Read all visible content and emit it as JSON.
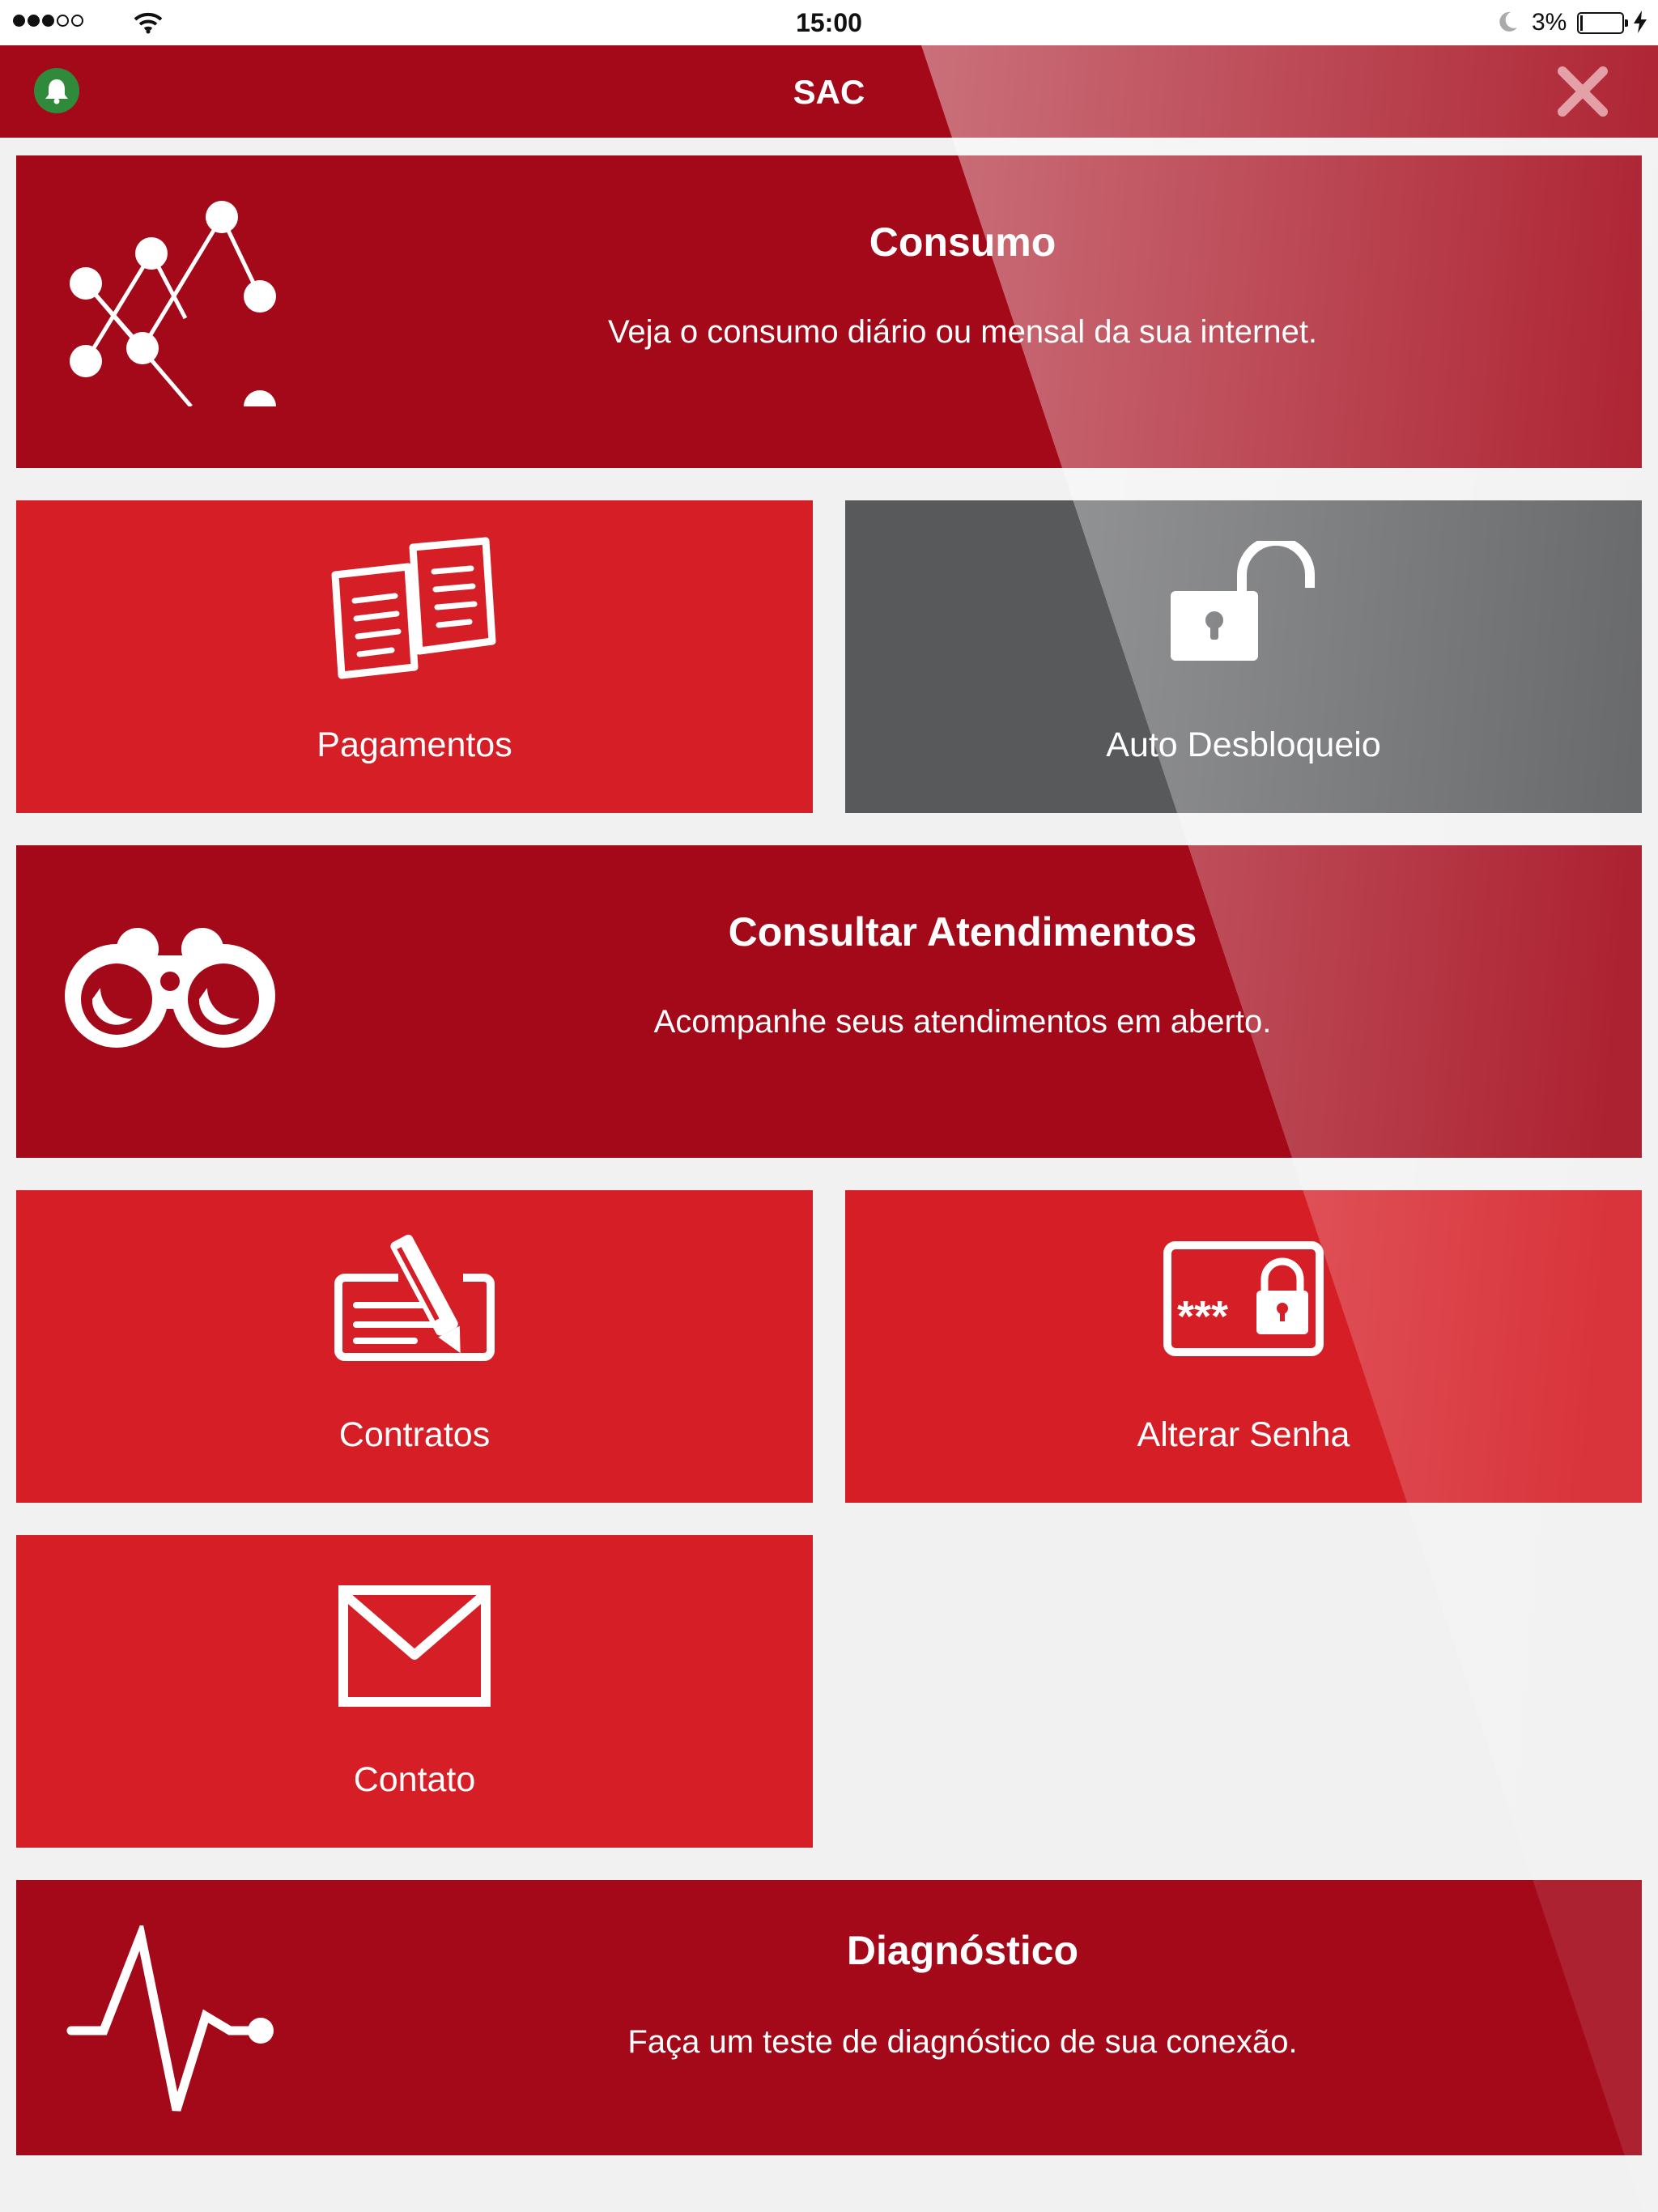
{
  "status_bar": {
    "time": "15:00",
    "battery_percent": "3%"
  },
  "nav": {
    "title": "SAC"
  },
  "tiles": {
    "consumo": {
      "title": "Consumo",
      "description": "Veja o consumo diário ou mensal da sua internet.",
      "icon": "network-graph-icon"
    },
    "pagamentos": {
      "label": "Pagamentos",
      "icon": "documents-icon"
    },
    "auto_desbloqueio": {
      "label": "Auto Desbloqueio",
      "icon": "unlocked-padlock-icon"
    },
    "atendimentos": {
      "title": "Consultar Atendimentos",
      "description": "Acompanhe seus atendimentos em aberto.",
      "icon": "binoculars-icon"
    },
    "contratos": {
      "label": "Contratos",
      "icon": "contract-signing-icon"
    },
    "alterar_senha": {
      "label": "Alterar Senha",
      "icon": "password-lock-icon",
      "password_mask": "***"
    },
    "contato": {
      "label": "Contato",
      "icon": "envelope-icon"
    },
    "diagnostico": {
      "title": "Diagnóstico",
      "description": "Faça um teste de diagnóstico de sua conexão.",
      "icon": "pulse-icon"
    }
  },
  "colors": {
    "dark_red": "#a4091a",
    "red": "#d51e26",
    "grey": "#58595b",
    "bell_green": "#2f8a3c",
    "background": "#f0f1f0"
  }
}
